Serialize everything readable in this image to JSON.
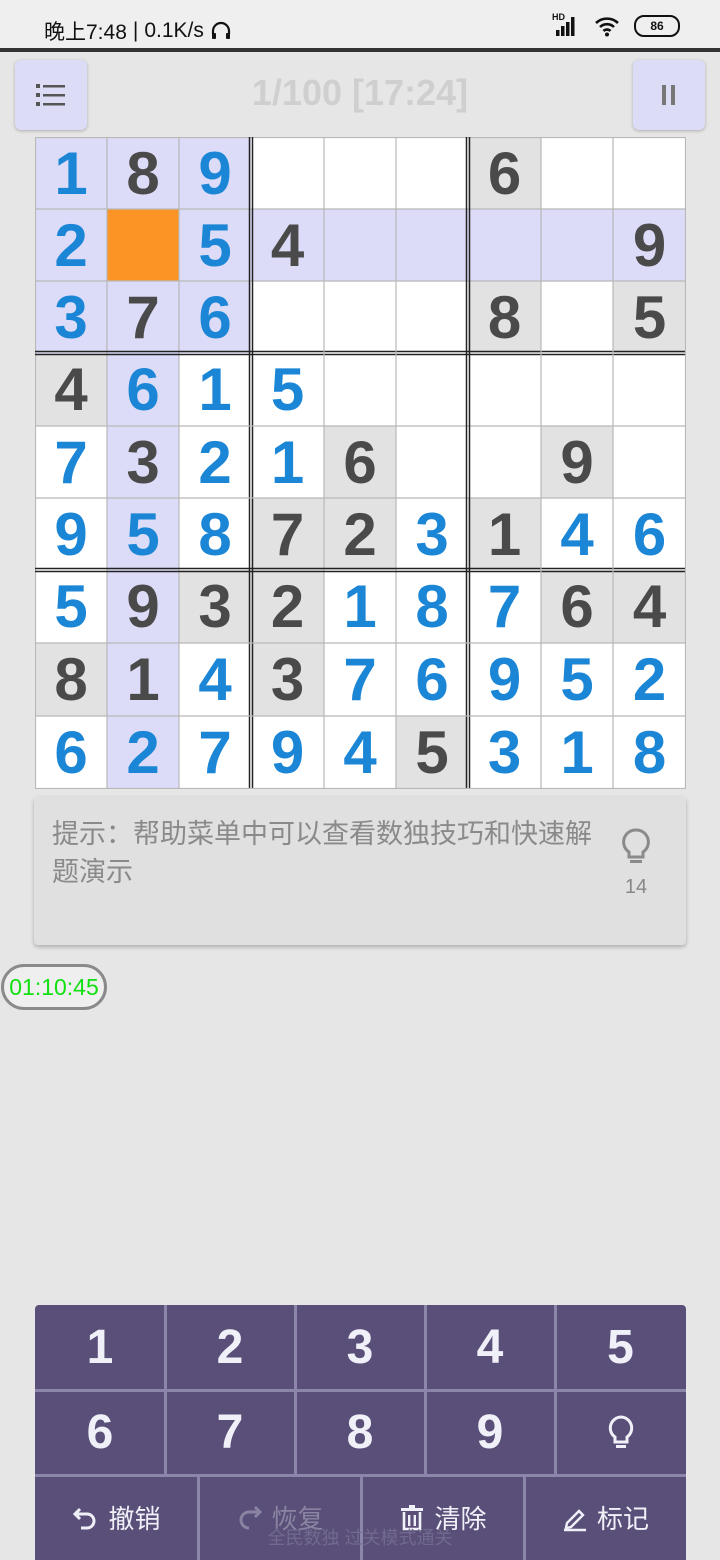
{
  "status_bar": {
    "time": "晚上7:48",
    "network_speed": "0.1K/s",
    "separator": "|",
    "battery": "86",
    "signal_label": "HD"
  },
  "header": {
    "title": "1/100 [17:24]",
    "menu_icon": "list-icon",
    "pause_icon": "pause-icon"
  },
  "colors": {
    "user_digit": "#1c86d6",
    "given_digit": "#4a4a4a",
    "selected_cell": "#fb9325",
    "highlight_cell": "#dcdcf8",
    "given_cell_bg": "#e2e2e2",
    "keypad_bg": "#5a4f78",
    "timer_text": "#11e011"
  },
  "board": {
    "selected": [
      1,
      1
    ],
    "highlight_row": 1,
    "highlight_col": 1,
    "highlight_box": [
      0,
      0
    ],
    "rows": [
      [
        {
          "v": "1",
          "t": "u"
        },
        {
          "v": "8",
          "t": "g"
        },
        {
          "v": "9",
          "t": "u"
        },
        {
          "v": "",
          "t": ""
        },
        {
          "v": "",
          "t": ""
        },
        {
          "v": "",
          "t": ""
        },
        {
          "v": "6",
          "t": "g"
        },
        {
          "v": "",
          "t": ""
        },
        {
          "v": "",
          "t": ""
        }
      ],
      [
        {
          "v": "2",
          "t": "u"
        },
        {
          "v": "",
          "t": ""
        },
        {
          "v": "5",
          "t": "u"
        },
        {
          "v": "4",
          "t": "g"
        },
        {
          "v": "",
          "t": ""
        },
        {
          "v": "",
          "t": ""
        },
        {
          "v": "",
          "t": ""
        },
        {
          "v": "",
          "t": ""
        },
        {
          "v": "9",
          "t": "g"
        }
      ],
      [
        {
          "v": "3",
          "t": "u"
        },
        {
          "v": "7",
          "t": "g"
        },
        {
          "v": "6",
          "t": "u"
        },
        {
          "v": "",
          "t": ""
        },
        {
          "v": "",
          "t": ""
        },
        {
          "v": "",
          "t": ""
        },
        {
          "v": "8",
          "t": "g"
        },
        {
          "v": "",
          "t": ""
        },
        {
          "v": "5",
          "t": "g"
        }
      ],
      [
        {
          "v": "4",
          "t": "g"
        },
        {
          "v": "6",
          "t": "u"
        },
        {
          "v": "1",
          "t": "u"
        },
        {
          "v": "5",
          "t": "u"
        },
        {
          "v": "",
          "t": ""
        },
        {
          "v": "",
          "t": ""
        },
        {
          "v": "",
          "t": ""
        },
        {
          "v": "",
          "t": ""
        },
        {
          "v": "",
          "t": ""
        }
      ],
      [
        {
          "v": "7",
          "t": "u"
        },
        {
          "v": "3",
          "t": "g"
        },
        {
          "v": "2",
          "t": "u"
        },
        {
          "v": "1",
          "t": "u"
        },
        {
          "v": "6",
          "t": "g"
        },
        {
          "v": "",
          "t": ""
        },
        {
          "v": "",
          "t": ""
        },
        {
          "v": "9",
          "t": "g"
        },
        {
          "v": "",
          "t": ""
        }
      ],
      [
        {
          "v": "9",
          "t": "u"
        },
        {
          "v": "5",
          "t": "u"
        },
        {
          "v": "8",
          "t": "u"
        },
        {
          "v": "7",
          "t": "g"
        },
        {
          "v": "2",
          "t": "g"
        },
        {
          "v": "3",
          "t": "u"
        },
        {
          "v": "1",
          "t": "g"
        },
        {
          "v": "4",
          "t": "u"
        },
        {
          "v": "6",
          "t": "u"
        }
      ],
      [
        {
          "v": "5",
          "t": "u"
        },
        {
          "v": "9",
          "t": "g"
        },
        {
          "v": "3",
          "t": "g"
        },
        {
          "v": "2",
          "t": "g"
        },
        {
          "v": "1",
          "t": "u"
        },
        {
          "v": "8",
          "t": "u"
        },
        {
          "v": "7",
          "t": "u"
        },
        {
          "v": "6",
          "t": "g"
        },
        {
          "v": "4",
          "t": "g"
        }
      ],
      [
        {
          "v": "8",
          "t": "g"
        },
        {
          "v": "1",
          "t": "g"
        },
        {
          "v": "4",
          "t": "u"
        },
        {
          "v": "3",
          "t": "g"
        },
        {
          "v": "7",
          "t": "u"
        },
        {
          "v": "6",
          "t": "u"
        },
        {
          "v": "9",
          "t": "u"
        },
        {
          "v": "5",
          "t": "u"
        },
        {
          "v": "2",
          "t": "u"
        }
      ],
      [
        {
          "v": "6",
          "t": "u"
        },
        {
          "v": "2",
          "t": "u"
        },
        {
          "v": "7",
          "t": "u"
        },
        {
          "v": "9",
          "t": "u"
        },
        {
          "v": "4",
          "t": "u"
        },
        {
          "v": "5",
          "t": "g"
        },
        {
          "v": "3",
          "t": "u"
        },
        {
          "v": "1",
          "t": "u"
        },
        {
          "v": "8",
          "t": "u"
        }
      ]
    ]
  },
  "hint": {
    "text": "提示：帮助菜单中可以查看数独技巧和快速解题演示",
    "count": "14",
    "icon": "lightbulb-icon"
  },
  "timer": "01:10:45",
  "keypad": {
    "numbers": [
      "1",
      "2",
      "3",
      "4",
      "5",
      "6",
      "7",
      "8",
      "9"
    ],
    "hint_icon": "lightbulb-icon",
    "actions": [
      {
        "label": "撤销",
        "icon": "undo-icon",
        "enabled": true
      },
      {
        "label": "恢复",
        "icon": "redo-icon",
        "enabled": false
      },
      {
        "label": "清除",
        "icon": "trash-icon",
        "enabled": true
      },
      {
        "label": "标记",
        "icon": "pencil-icon",
        "enabled": true
      }
    ]
  },
  "watermark": "全民数独 过关模式通关"
}
